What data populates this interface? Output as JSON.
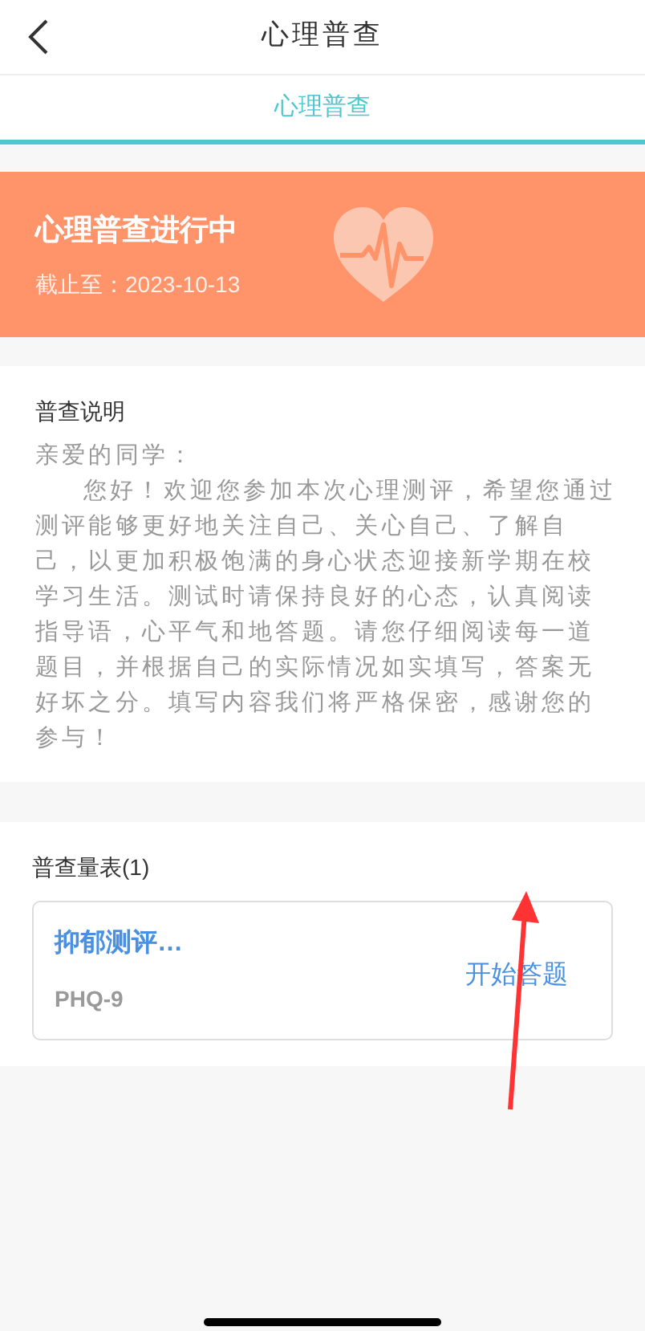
{
  "header": {
    "title": "心理普查"
  },
  "tabs": [
    {
      "label": "心理普查",
      "selected": true
    }
  ],
  "banner": {
    "title": "心理普查进行中",
    "deadline": "截止至：2023-10-13"
  },
  "instructions": {
    "heading": "普查说明",
    "greeting": "亲爱的同学：",
    "body": "您好！欢迎您参加本次心理测评，希望您通过测评能够更好地关注自己、关心自己、了解自己，以更加积极饱满的身心状态迎接新学期在校学习生活。测试时请保持良好的心态，认真阅读指导语，心平气和地答题。请您仔细阅读每一道题目，并根据自己的实际情况如实填写，答案无好坏之分。填写内容我们将严格保密，感谢您的参与！"
  },
  "scales": {
    "heading": "普查量表(1)",
    "items": [
      {
        "title": "抑郁测评…",
        "code": "PHQ-9",
        "action": "开始答题"
      }
    ]
  }
}
